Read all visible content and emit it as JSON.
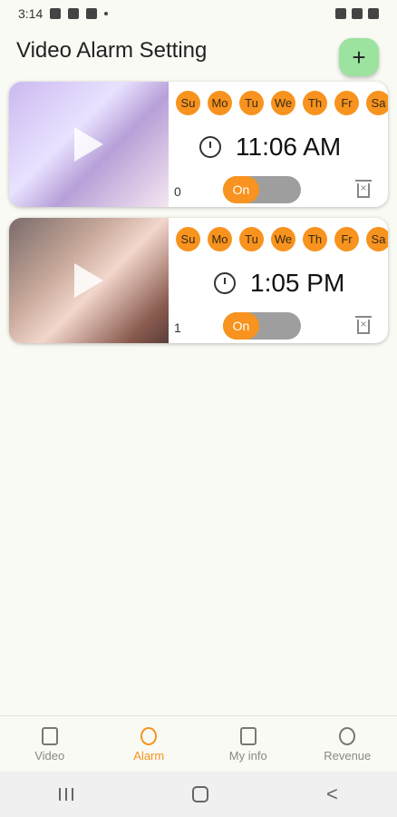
{
  "status_bar": {
    "time": "3:14"
  },
  "header": {
    "title": "Video Alarm Setting",
    "add_label": "+"
  },
  "alarms": [
    {
      "days": [
        "Su",
        "Mo",
        "Tu",
        "We",
        "Th",
        "Fr",
        "Sa"
      ],
      "time": "11:06 AM",
      "index": "0",
      "toggle_label": "On"
    },
    {
      "days": [
        "Su",
        "Mo",
        "Tu",
        "We",
        "Th",
        "Fr",
        "Sa"
      ],
      "time": "1:05 PM",
      "index": "1",
      "toggle_label": "On"
    }
  ],
  "bottom_nav": {
    "items": [
      {
        "label": "Video",
        "icon": "file-video-icon"
      },
      {
        "label": "Alarm",
        "icon": "alarm-clock-icon"
      },
      {
        "label": "My info",
        "icon": "clipboard-icon"
      },
      {
        "label": "Revenue",
        "icon": "dollar-icon"
      }
    ],
    "active": "Alarm"
  },
  "system_nav": {
    "back_glyph": "<"
  },
  "colors": {
    "accent": "#f7931e",
    "fab": "#9be39e",
    "background": "#fafaf4"
  }
}
